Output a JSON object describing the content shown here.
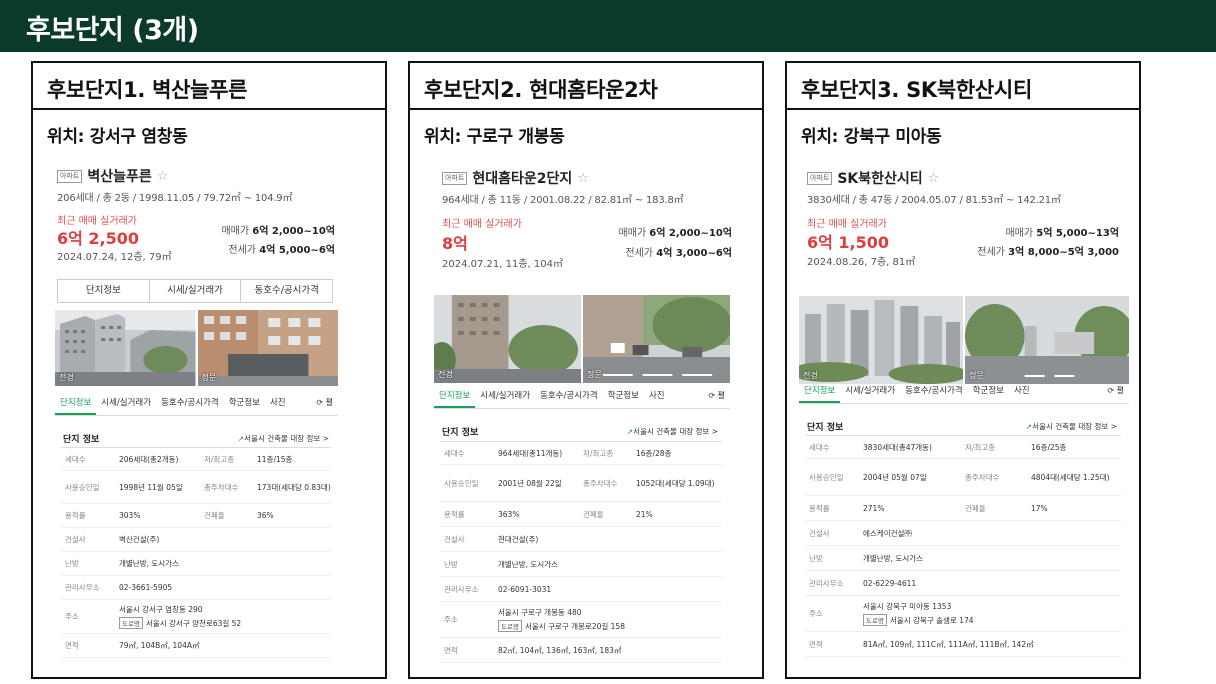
{
  "header": {
    "title": "후보단지 (3개)"
  },
  "candidates": [
    {
      "title": "후보단지1. 벽산늘푸른",
      "location": "위치: 강서구 염창동",
      "badge": "아파트",
      "name": "벽산늘푸른",
      "meta": "206세대 / 총 2동 / 1998.11.05 / 79.72㎡ ~ 104.9㎡",
      "recent_label": "최근 매매 실거래가",
      "recent_price": "6억 2,500",
      "recent_date": "2024.07.24, 12층, 79㎡",
      "sale_label": "매매가",
      "sale_range": "6억 2,000~10억",
      "rent_label": "전세가",
      "rent_range": "4억 5,000~6억",
      "buttons": [
        "단지정보",
        "시세/실거래가",
        "동호수/공시가격"
      ],
      "photo_captions": [
        "전경",
        "정문"
      ],
      "tabs": [
        "단지정보",
        "시세/실거래가",
        "동호수/공시가격",
        "학군정보",
        "사진"
      ],
      "tab_expand": "펼",
      "info_title": "단지 정보",
      "info_link": "서울시 건축물 대장 정보 >",
      "rows": {
        "households_label": "세대수",
        "households": "206세대(총2개동)",
        "floors_label": "저/최고층",
        "floors": "11층/15층",
        "approval_label": "사용승인일",
        "approval": "1998년 11월 05일",
        "parking_label": "총주차대수",
        "parking": "173대(세대당 0.83대)",
        "far_label": "용적률",
        "far": "303%",
        "bcr_label": "건폐율",
        "bcr": "36%",
        "builder_label": "건설사",
        "builder": "벽산건설(주)",
        "heating_label": "난방",
        "heating": "개별난방, 도시가스",
        "office_label": "관리사무소",
        "office": "02-3661-5905",
        "address_label": "주소",
        "address": "서울시 강서구 염창동 290",
        "road_tag": "도로명",
        "road_address": "서울시 강서구 양천로63길 52",
        "area_label": "면적",
        "area": "79㎡, 104B㎡, 104A㎡"
      }
    },
    {
      "title": "후보단지2. 현대홈타운2차",
      "location": "위치: 구로구 개봉동",
      "badge": "아파트",
      "name": "현대홈타운2단지",
      "meta": "964세대 / 총 11동 / 2001.08.22 / 82.81㎡ ~ 183.8㎡",
      "recent_label": "최근 매매 실거래가",
      "recent_price": "8억",
      "recent_date": "2024.07.21, 11층, 104㎡",
      "sale_label": "매매가",
      "sale_range": "6억 2,000~10억",
      "rent_label": "전세가",
      "rent_range": "4억 3,000~6억",
      "photo_captions": [
        "전경",
        "정문"
      ],
      "tabs": [
        "단지정보",
        "시세/실거래가",
        "동호수/공시가격",
        "학군정보",
        "사진"
      ],
      "tab_expand": "펼",
      "info_title": "단지 정보",
      "info_link": "서울시 건축물 대장 정보 >",
      "rows": {
        "households_label": "세대수",
        "households": "964세대(총11개동)",
        "floors_label": "저/최고층",
        "floors": "16층/28층",
        "approval_label": "사용승인일",
        "approval": "2001년 08월 22일",
        "parking_label": "총주차대수",
        "parking": "1052대(세대당 1.09대)",
        "far_label": "용적률",
        "far": "363%",
        "bcr_label": "건폐율",
        "bcr": "21%",
        "builder_label": "건설사",
        "builder": "현대건설(주)",
        "heating_label": "난방",
        "heating": "개별난방, 도시가스",
        "office_label": "관리사무소",
        "office": "02-6091-3031",
        "address_label": "주소",
        "address": "서울시 구로구 개봉동 480",
        "road_tag": "도로명",
        "road_address": "서울시 구로구 개봉로20길 158",
        "area_label": "면적",
        "area": "82㎡, 104㎡, 136㎡, 163㎡, 183㎡"
      }
    },
    {
      "title": "후보단지3. SK북한산시티",
      "location": "위치: 강북구 미아동",
      "badge": "아파트",
      "name": "SK북한산시티",
      "meta": "3830세대 / 총 47동 / 2004.05.07 / 81.53㎡ ~ 142.21㎡",
      "recent_label": "최근 매매 실거래가",
      "recent_price": "6억 1,500",
      "recent_date": "2024.08.26, 7층, 81㎡",
      "sale_label": "매매가",
      "sale_range": "5억 5,000~13억",
      "rent_label": "전세가",
      "rent_range": "3억 8,000~5억 3,000",
      "photo_captions": [
        "전경",
        "정문"
      ],
      "tabs": [
        "단지정보",
        "시세/실거래가",
        "동호수/공시가격",
        "학군정보",
        "사진"
      ],
      "tab_expand": "펼",
      "info_title": "단지 정보",
      "info_link": "서울시 건축물 대장 정보 >",
      "rows": {
        "households_label": "세대수",
        "households": "3830세대(총47개동)",
        "floors_label": "저/최고층",
        "floors": "16층/25층",
        "approval_label": "사용승인일",
        "approval": "2004년 05월 07일",
        "parking_label": "총주차대수",
        "parking": "4804대(세대당 1.25대)",
        "far_label": "용적률",
        "far": "271%",
        "bcr_label": "건폐율",
        "bcr": "17%",
        "builder_label": "건설사",
        "builder": "에스케이건설㈜",
        "heating_label": "난방",
        "heating": "개별난방, 도시가스",
        "office_label": "관리사무소",
        "office": "02-6229-4611",
        "address_label": "주소",
        "address": "서울시 강북구 미아동 1353",
        "road_tag": "도로명",
        "road_address": "서울시 강북구 솔샘로 174",
        "area_label": "면적",
        "area": "81A㎡, 109㎡, 111C㎡, 111A㎡, 111B㎡, 142㎡"
      }
    }
  ]
}
